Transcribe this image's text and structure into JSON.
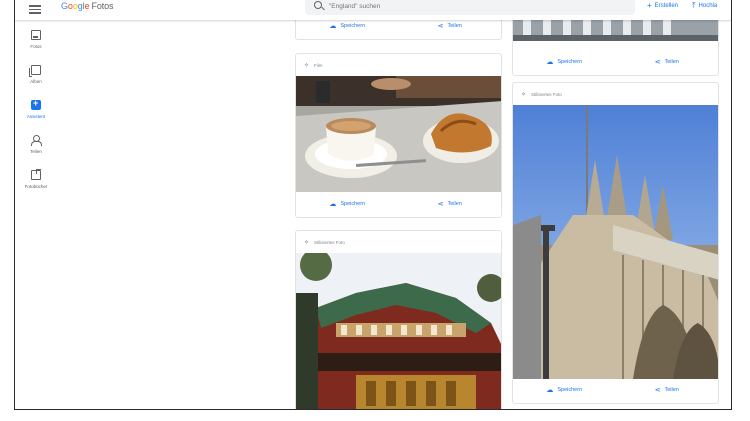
{
  "app": {
    "logo_letters": [
      "G",
      "o",
      "o",
      "g",
      "l",
      "e"
    ],
    "logo_suffix": "Fotos"
  },
  "search": {
    "placeholder": "\"England\" suchen"
  },
  "top_actions": {
    "create_label": "Erstellen",
    "upload_label": "Hochla"
  },
  "sidebar": {
    "items": [
      {
        "label": "Fotos",
        "icon": "photo-icon"
      },
      {
        "label": "Alben",
        "icon": "album-icon"
      },
      {
        "label": "Assistent",
        "icon": "assistant-icon",
        "active": true
      },
      {
        "label": "Teilen",
        "icon": "sharing-icon"
      },
      {
        "label": "Fotobücher",
        "icon": "photobook-icon"
      }
    ]
  },
  "cards": {
    "save_label": "Speichern",
    "share_label": "Teilen",
    "film_label": "Film",
    "stylized_label": "Stilisiertes Foto"
  },
  "colors": {
    "accent": "#1a73e8",
    "icon_grey": "#5f6368"
  }
}
